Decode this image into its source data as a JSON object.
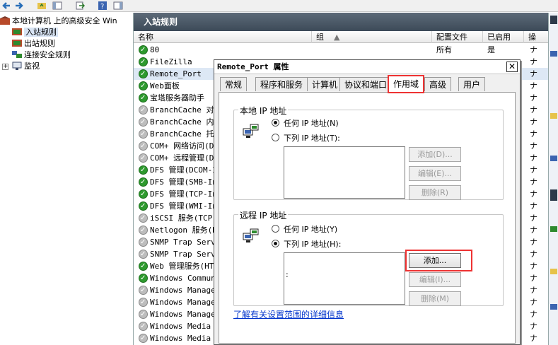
{
  "tree": {
    "root": "本地计算机 上的高级安全 Win",
    "items": [
      {
        "label": "入站规则",
        "selected": true
      },
      {
        "label": "出站规则",
        "selected": false
      },
      {
        "label": "连接安全规则",
        "selected": false
      },
      {
        "label": "监视",
        "selected": false
      }
    ]
  },
  "center": {
    "title": "入站规则",
    "columns": [
      "名称",
      "组",
      "配置文件",
      "已启用",
      "操"
    ],
    "rows": [
      {
        "name": "80",
        "profile": "所有",
        "enabled": "是",
        "status": "on"
      },
      {
        "name": "FileZilla",
        "profile": "",
        "enabled": "",
        "status": "on"
      },
      {
        "name": "Remote_Port",
        "profile": "",
        "enabled": "",
        "status": "on"
      },
      {
        "name": "Web面板",
        "profile": "",
        "enabled": "",
        "status": "on"
      },
      {
        "name": "宝塔服务器助手",
        "profile": "",
        "enabled": "",
        "status": "on"
      },
      {
        "name": "BranchCache 对等",
        "profile": "",
        "enabled": "",
        "status": "off"
      },
      {
        "name": "BranchCache 内容",
        "profile": "",
        "enabled": "",
        "status": "off"
      },
      {
        "name": "BranchCache 托管",
        "profile": "",
        "enabled": "",
        "status": "off"
      },
      {
        "name": "COM+ 网络访问(D",
        "profile": "",
        "enabled": "",
        "status": "off"
      },
      {
        "name": "COM+ 远程管理(D",
        "profile": "",
        "enabled": "",
        "status": "off"
      },
      {
        "name": "DFS 管理(DCOM-I",
        "profile": "",
        "enabled": "",
        "status": "on"
      },
      {
        "name": "DFS 管理(SMB-In",
        "profile": "",
        "enabled": "",
        "status": "on"
      },
      {
        "name": "DFS 管理(TCP-In",
        "profile": "",
        "enabled": "",
        "status": "on"
      },
      {
        "name": "DFS 管理(WMI-In",
        "profile": "",
        "enabled": "",
        "status": "on"
      },
      {
        "name": "iSCSI 服务(TCP-",
        "profile": "",
        "enabled": "",
        "status": "off"
      },
      {
        "name": "Netlogon 服务(N",
        "profile": "",
        "enabled": "",
        "status": "off"
      },
      {
        "name": "SNMP Trap Servi",
        "profile": "",
        "enabled": "",
        "status": "off"
      },
      {
        "name": "SNMP Trap Servi",
        "profile": "",
        "enabled": "",
        "status": "off"
      },
      {
        "name": "Web 管理服务(HT",
        "profile": "",
        "enabled": "",
        "status": "on"
      },
      {
        "name": "Windows Communi",
        "profile": "",
        "enabled": "",
        "status": "on"
      },
      {
        "name": "Windows Managem",
        "profile": "",
        "enabled": "",
        "status": "off"
      },
      {
        "name": "Windows Managem",
        "profile": "",
        "enabled": "",
        "status": "off"
      },
      {
        "name": "Windows Managem",
        "profile": "",
        "enabled": "",
        "status": "off"
      },
      {
        "name": "Windows Media P",
        "profile": "",
        "enabled": "",
        "status": "off"
      },
      {
        "name": "Windows Media P",
        "profile": "",
        "enabled": "",
        "status": "off"
      }
    ],
    "edge_char": "ナ"
  },
  "dialog": {
    "title": "Remote_Port 属性",
    "close": "✕",
    "tabs": [
      {
        "label": "常规",
        "active": false
      },
      {
        "label": "程序和服务",
        "active": false
      },
      {
        "label": "计算机",
        "active": false
      },
      {
        "label": "协议和端口",
        "active": false
      },
      {
        "label": "作用域",
        "active": true
      },
      {
        "label": "高级",
        "active": false
      },
      {
        "label": "用户",
        "active": false
      }
    ],
    "local": {
      "group_label": "本地 IP 地址",
      "any_label": "任何 IP 地址(N)",
      "these_label": "下列 IP 地址(T):",
      "selected": "any",
      "add": "添加(D)...",
      "edit": "编辑(E)...",
      "remove": "删除(R)"
    },
    "remote": {
      "group_label": "远程 IP 地址",
      "any_label": "任何 IP 地址(Y)",
      "these_label": "下列 IP 地址(H):",
      "selected": "these",
      "list_value": ":",
      "add": "添加...",
      "edit": "编辑(I)...",
      "remove": "删除(M)"
    },
    "link": "了解有关设置范围的详细信息"
  }
}
